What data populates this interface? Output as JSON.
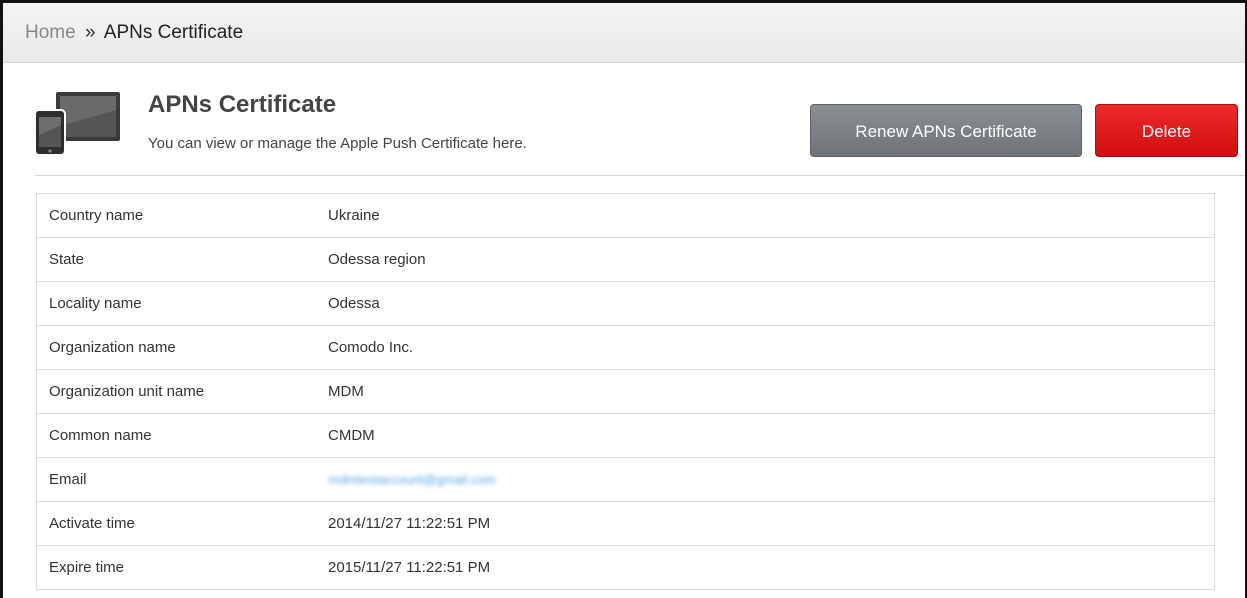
{
  "breadcrumb": {
    "home": "Home",
    "separator": "»",
    "current": "APNs Certificate"
  },
  "header": {
    "title": "APNs Certificate",
    "subtitle": "You can view or manage the Apple Push Certificate here.",
    "icon": "devices-icon"
  },
  "actions": {
    "renew_label": "Renew APNs Certificate",
    "delete_label": "Delete"
  },
  "certificate": {
    "rows": [
      {
        "label": "Country name",
        "value": "Ukraine"
      },
      {
        "label": "State",
        "value": "Odessa region"
      },
      {
        "label": "Locality name",
        "value": "Odessa"
      },
      {
        "label": "Organization name",
        "value": "Comodo Inc."
      },
      {
        "label": "Organization unit name",
        "value": "MDM"
      },
      {
        "label": "Common name",
        "value": "CMDM"
      },
      {
        "label": "Email",
        "value": "mdmtestaccount@gmail.com"
      },
      {
        "label": "Activate time",
        "value": "2014/11/27 11:22:51 PM"
      },
      {
        "label": "Expire time",
        "value": "2015/11/27 11:22:51 PM"
      }
    ]
  },
  "colors": {
    "delete": "#e01a1a",
    "renew": "#7c8186",
    "breadcrumb_bg": "#eeeeee"
  }
}
